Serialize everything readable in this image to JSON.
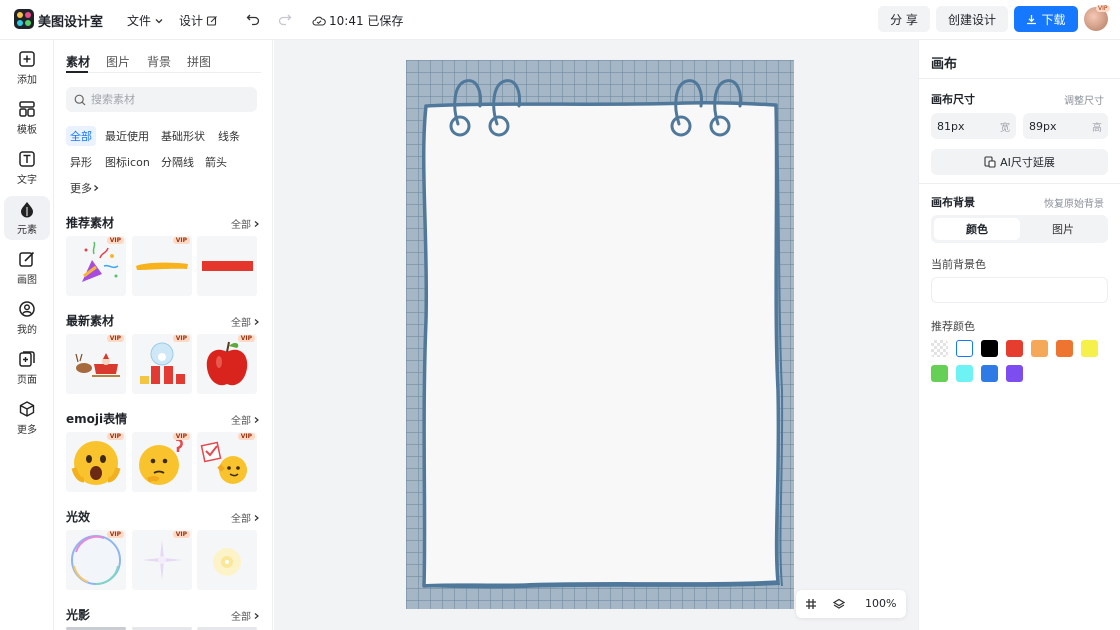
{
  "app": {
    "name": "美图设计室",
    "menu": {
      "file": "文件",
      "design": "设计"
    },
    "save_status": "10:41 已保存",
    "share_label": "分 享",
    "create_label": "创建设计",
    "download_label": "下载",
    "avatar_vip": "VIP"
  },
  "rail": [
    {
      "label": "添加",
      "icon": "plus-square-icon"
    },
    {
      "label": "模板",
      "icon": "template-icon"
    },
    {
      "label": "文字",
      "icon": "text-icon"
    },
    {
      "label": "元素",
      "icon": "shapes-icon",
      "active": true
    },
    {
      "label": "画图",
      "icon": "pen-icon"
    },
    {
      "label": "我的",
      "icon": "user-icon"
    },
    {
      "label": "页面",
      "icon": "page-add-icon"
    },
    {
      "label": "更多",
      "icon": "cube-icon"
    }
  ],
  "panel": {
    "tabs": [
      "素材",
      "图片",
      "背景",
      "拼图"
    ],
    "search_placeholder": "搜索素材",
    "chips": [
      "全部",
      "最近使用",
      "基础形状",
      "线条",
      "异形",
      "图标icon",
      "分隔线",
      "箭头",
      "更多"
    ],
    "all_label": "全部",
    "vip_label": "VIP",
    "sections": [
      {
        "title": "推荐素材",
        "items": [
          "party-popper",
          "yellow-stroke",
          "red-bar"
        ]
      },
      {
        "title": "最新素材",
        "items": [
          "reindeer-sleigh",
          "snow-globe-gift",
          "red-apple"
        ]
      },
      {
        "title": "emoji表情",
        "items": [
          "shocked-emoji",
          "thinking-emoji",
          "checkmark-emoji"
        ]
      },
      {
        "title": "光效",
        "items": [
          "rainbow-bubble",
          "purple-sparkle",
          "yellow-glow"
        ]
      },
      {
        "title": "光影",
        "items": []
      }
    ]
  },
  "workspace": {
    "zoom_label": "100%"
  },
  "rpanel": {
    "title": "画布",
    "size_label": "画布尺寸",
    "adjust_label": "调整尺寸",
    "width_value": "81px",
    "width_unit": "宽",
    "height_value": "89px",
    "height_unit": "高",
    "ai_label": "AI尺寸延展",
    "bg_label": "画布背景",
    "reset_label": "恢复原始背景",
    "seg_color": "颜色",
    "seg_image": "图片",
    "current_color_label": "当前背景色",
    "recommend_label": "推荐颜色",
    "swatches": [
      "transparent",
      "#ffffff",
      "#000000",
      "#e53e2e",
      "#f5a857",
      "#ee7530",
      "#f6f04a",
      "#66d056",
      "#6ff2f4",
      "#2e7be6",
      "#7e4df0"
    ]
  }
}
